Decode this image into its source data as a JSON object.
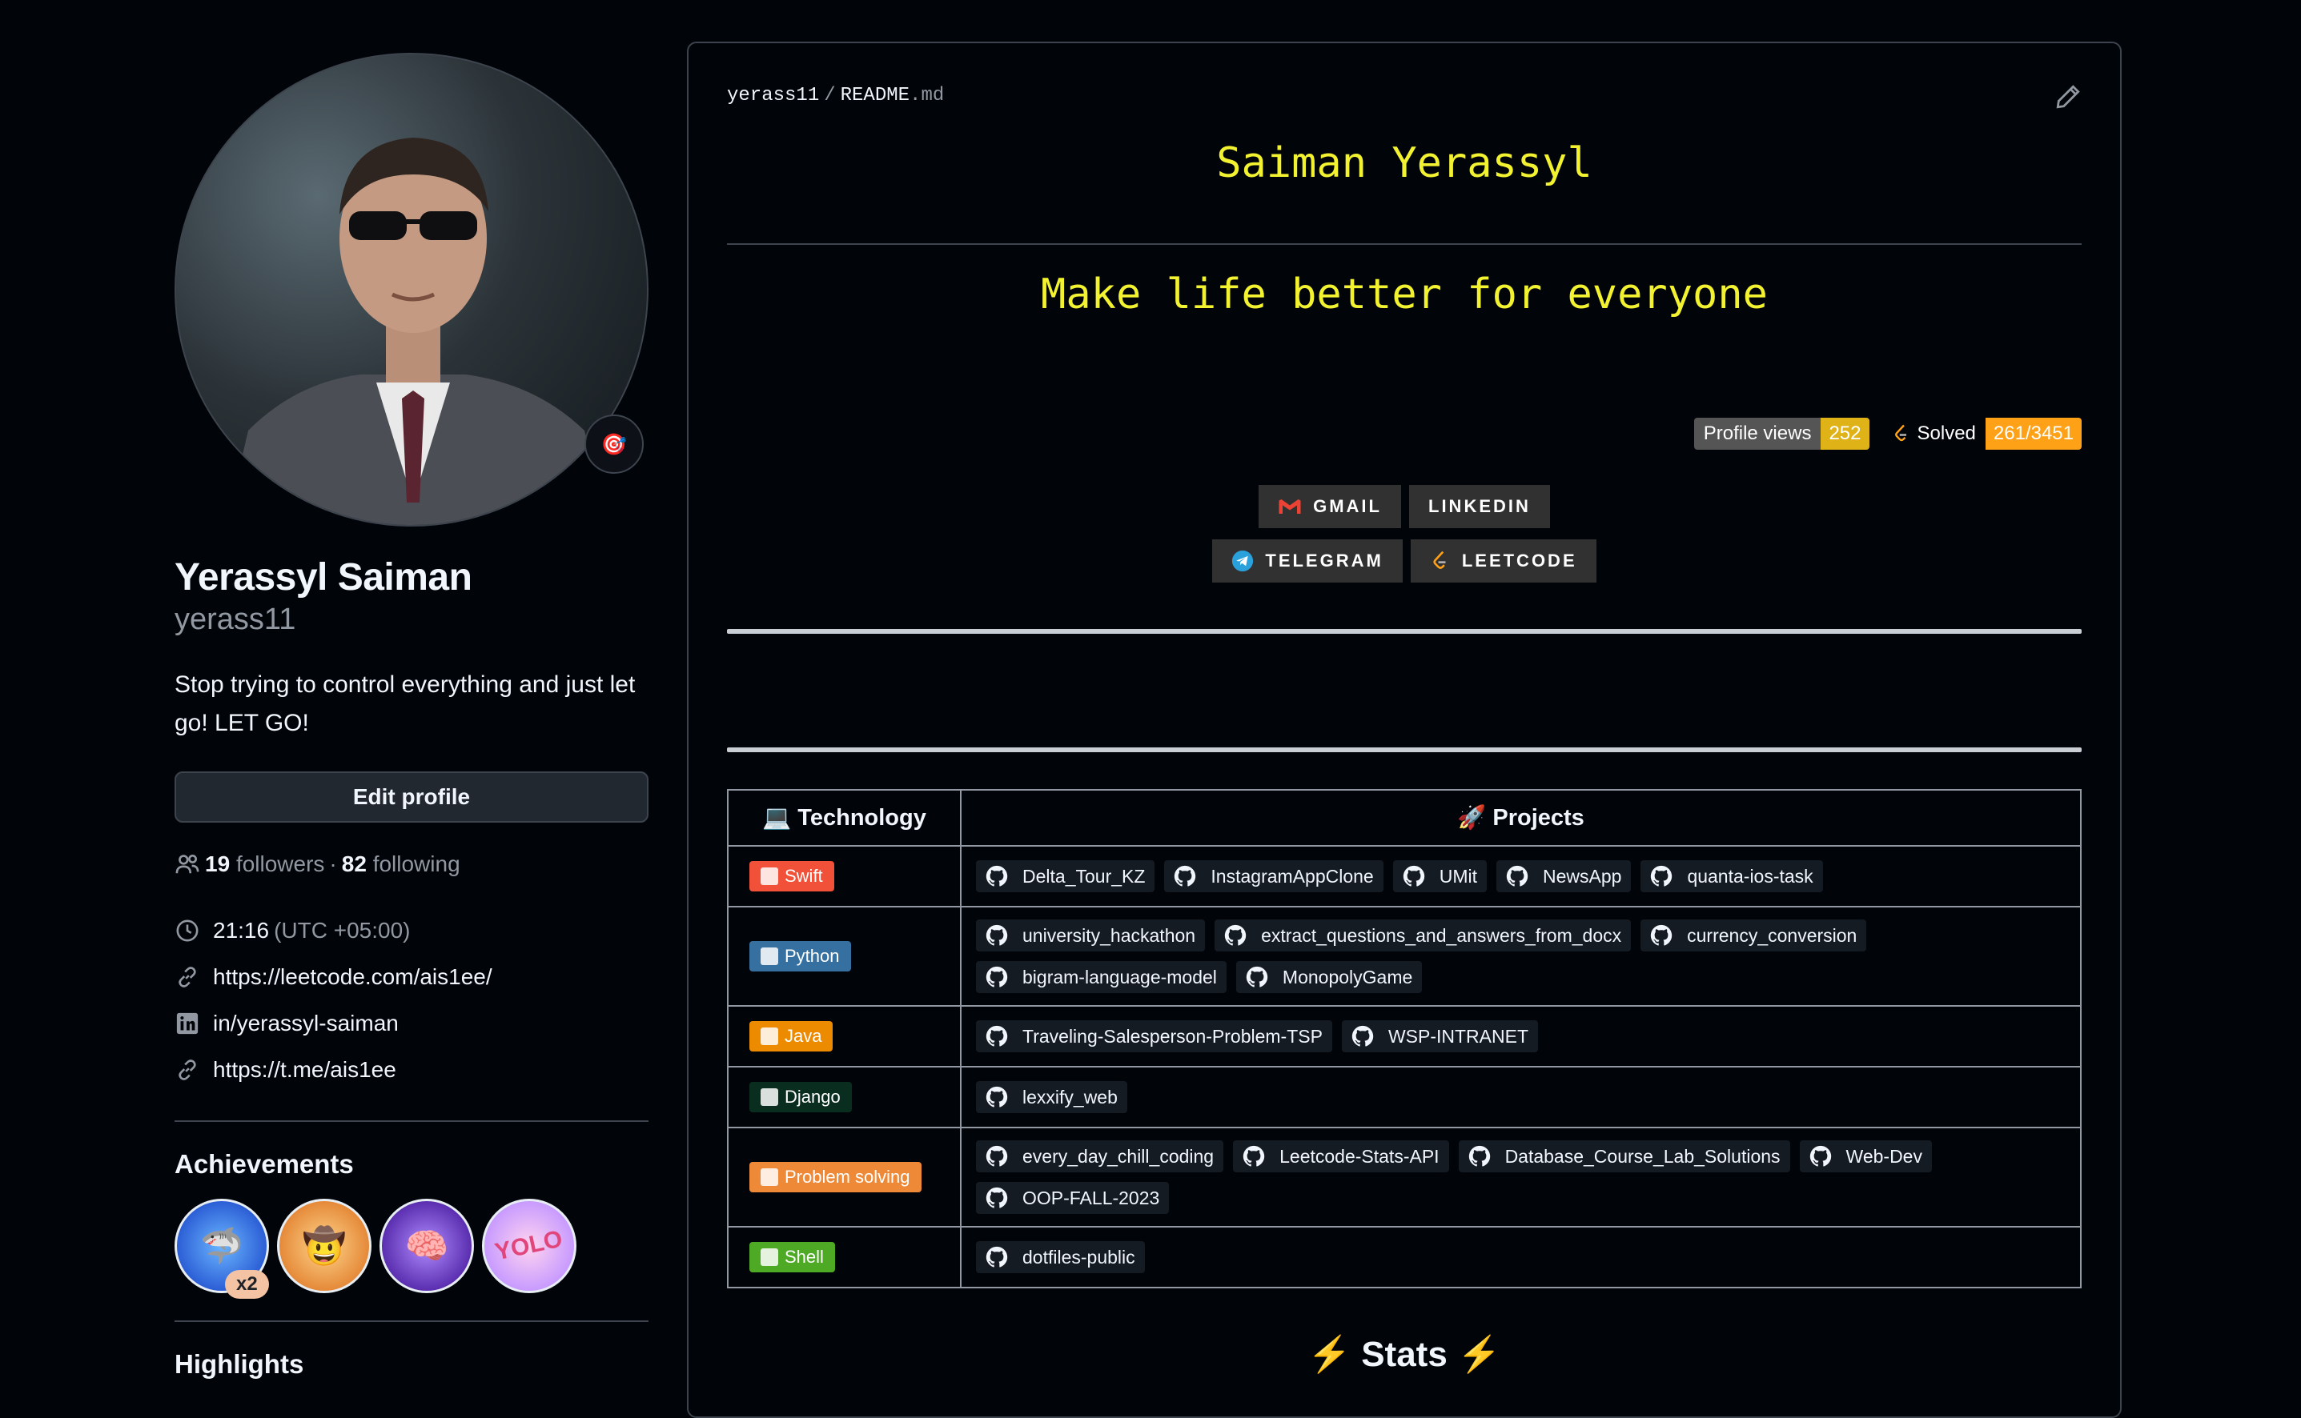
{
  "profile": {
    "status_emoji": "🎯",
    "name": "Yerassyl Saiman",
    "username": "yerass11",
    "bio": "Stop trying to control everything and just let go! LET GO!",
    "edit_label": "Edit profile",
    "followers_count": "19",
    "followers_label": "followers",
    "dot": "·",
    "following_count": "82",
    "following_label": "following",
    "time": "21:16",
    "timezone": "(UTC +05:00)",
    "link1": "https://leetcode.com/ais1ee/",
    "linkedin": "in/yerassyl-saiman",
    "link2": "https://t.me/ais1ee"
  },
  "achievements": {
    "title": "Achievements",
    "items": [
      {
        "name": "Pull Shark",
        "emoji": "🦈",
        "count": "x2"
      },
      {
        "name": "YOLO cowboy",
        "emoji": "🤠"
      },
      {
        "name": "Galaxy Brain",
        "emoji": "🧠"
      },
      {
        "name": "YOLO",
        "emoji": "YOLO"
      }
    ]
  },
  "highlights": {
    "title": "Highlights"
  },
  "readme": {
    "owner": "yerass11",
    "separator": "/",
    "file_name": "README",
    "file_ext": ".md",
    "title": "Saiman Yerassyl",
    "subtitle": "Make life better for everyone",
    "views_label": "Profile views",
    "views_value": "252",
    "solved_label": "Solved",
    "solved_value": "261/3451",
    "socials": [
      "GMAIL",
      "LINKEDIN",
      "TELEGRAM",
      "LEETCODE"
    ],
    "table_headers": [
      "💻 Technology",
      "🚀 Projects"
    ],
    "rows": [
      {
        "tech": "Swift",
        "color": "#f05138",
        "icon": "swift-icon",
        "repos": [
          "Delta_Tour_KZ",
          "InstagramAppClone",
          "UMit",
          "NewsApp",
          "quanta-ios-task"
        ]
      },
      {
        "tech": "Python",
        "color": "#3670a0",
        "icon": "python-icon",
        "repos": [
          "university_hackathon",
          "extract_questions_and_answers_from_docx",
          "currency_conversion",
          "bigram-language-model",
          "MonopolyGame"
        ]
      },
      {
        "tech": "Java",
        "color": "#ed8b00",
        "icon": "java-icon",
        "repos": [
          "Traveling-Salesperson-Problem-TSP",
          "WSP-INTRANET"
        ]
      },
      {
        "tech": "Django",
        "color": "#092e20",
        "icon": "django-icon",
        "repos": [
          "lexxify_web"
        ]
      },
      {
        "tech": "Problem solving",
        "color": "#ee8a37",
        "icon": "leetcode-icon",
        "repos": [
          "every_day_chill_coding",
          "Leetcode-Stats-API",
          "Database_Course_Lab_Solutions",
          "Web-Dev",
          "OOP-FALL-2023"
        ]
      },
      {
        "tech": "Shell",
        "color": "#4eaa25",
        "icon": "shell-icon",
        "repos": [
          "dotfiles-public"
        ]
      }
    ],
    "stats_title": "Stats",
    "stats_emoji": "⚡"
  },
  "colors": {
    "accent_yellow": "#f2f230",
    "bg": "#010409",
    "border": "#3d444d"
  }
}
